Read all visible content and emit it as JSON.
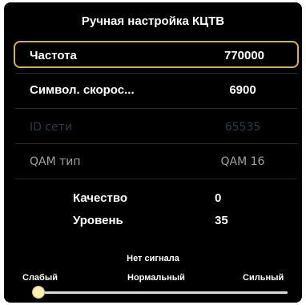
{
  "title": "Ручная настройка КЦТВ",
  "rows": [
    {
      "label": "Частота",
      "value": "770000"
    },
    {
      "label": "Символ. скорос...",
      "value": "6900"
    },
    {
      "label": "ID сети",
      "value": "65535"
    },
    {
      "label": "QAM тип",
      "value": "QAM 16"
    }
  ],
  "stats": {
    "quality_label": "Качество",
    "quality_value": "0",
    "level_label": "Уровень",
    "level_value": "35"
  },
  "signal": {
    "status": "Нет сигнала",
    "weak": "Слабый",
    "normal": "Нормальный",
    "strong": "Сильный",
    "level_fraction": 0.0
  },
  "colors": {
    "selection": "#d7b24a",
    "disabled": "#2f3a44",
    "secondary": "#9aa1a8"
  }
}
